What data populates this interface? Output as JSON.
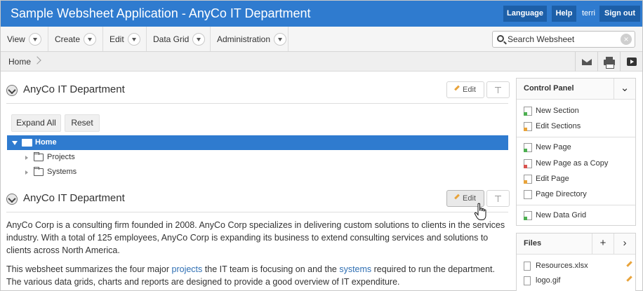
{
  "header": {
    "title": "Sample Websheet Application - AnyCo IT Department",
    "language_label": "Language",
    "help_label": "Help",
    "user": "terri",
    "signout_label": "Sign out",
    "accent_color": "#2f7bcf"
  },
  "menubar": {
    "items": [
      {
        "label": "View"
      },
      {
        "label": "Create"
      },
      {
        "label": "Edit"
      },
      {
        "label": "Data Grid"
      },
      {
        "label": "Administration"
      }
    ],
    "search": {
      "placeholder": "Search Websheet",
      "value": ""
    }
  },
  "breadcrumb": {
    "items": [
      "Home"
    ],
    "toolbar_icons": [
      "email-icon",
      "print-icon",
      "presentation-icon"
    ]
  },
  "main": {
    "regions": [
      {
        "title": "AnyCo IT Department",
        "edit_label": "Edit",
        "tree": {
          "expand_all_label": "Expand All",
          "reset_label": "Reset",
          "root": "Home",
          "children": [
            "Projects",
            "Systems"
          ]
        }
      },
      {
        "title": "AnyCo IT Department",
        "edit_label": "Edit",
        "paragraph1": "AnyCo Corp is a consulting firm founded in 2008. AnyCo Corp specializes in delivering custom solutions to clients in the services industry. With a total of 125 employees, AnyCo Corp is expanding its business to extend consulting services and solutions to clients across North America.",
        "paragraph2": {
          "part1": "This websheet summarizes the four major ",
          "link1": "projects",
          "part2": " the IT team is focusing on and the ",
          "link2": "systems",
          "part3": " required to run the department. The various data grids, charts and reports are designed to provide a good overview of IT expenditure."
        }
      }
    ]
  },
  "sidebar": {
    "control_panel": {
      "title": "Control Panel",
      "groups": [
        [
          "New Section",
          "Edit Sections"
        ],
        [
          "New Page",
          "New Page as a Copy",
          "Edit Page",
          "Page Directory"
        ],
        [
          "New Data Grid"
        ]
      ]
    },
    "files": {
      "title": "Files",
      "items": [
        "Resources.xlsx",
        "logo.gif"
      ]
    }
  }
}
